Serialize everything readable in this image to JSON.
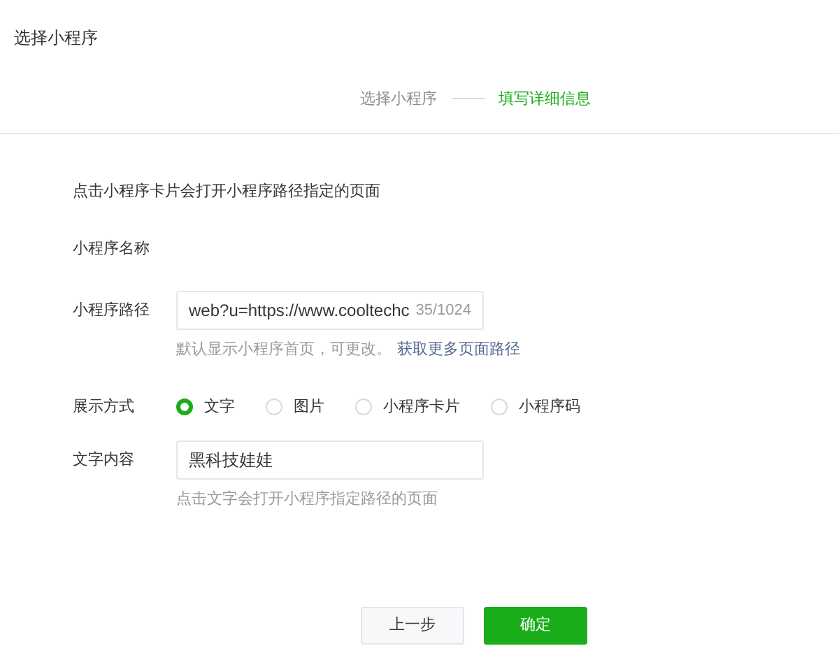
{
  "title": "选择小程序",
  "steps": [
    {
      "label": "选择小程序",
      "selected": false
    },
    {
      "label": "填写详细信息",
      "selected": true
    }
  ],
  "intro": "点击小程序卡片会打开小程序路径指定的页面",
  "name_label": "小程序名称",
  "path": {
    "label": "小程序路径",
    "value": "web?u=https://www.cooltechc",
    "counter": "35/1024",
    "hint": "默认显示小程序首页，可更改。",
    "link": "获取更多页面路径"
  },
  "display": {
    "label": "展示方式",
    "options": [
      {
        "label": "文字",
        "selected": true
      },
      {
        "label": "图片",
        "selected": false
      },
      {
        "label": "小程序卡片",
        "selected": false
      },
      {
        "label": "小程序码",
        "selected": false
      }
    ]
  },
  "text_content": {
    "label": "文字内容",
    "value": "黑科技娃娃",
    "hint": "点击文字会打开小程序指定路径的页面"
  },
  "buttons": [
    {
      "label": "上一步",
      "kind": "secondary"
    },
    {
      "label": "确定",
      "kind": "primary"
    }
  ]
}
